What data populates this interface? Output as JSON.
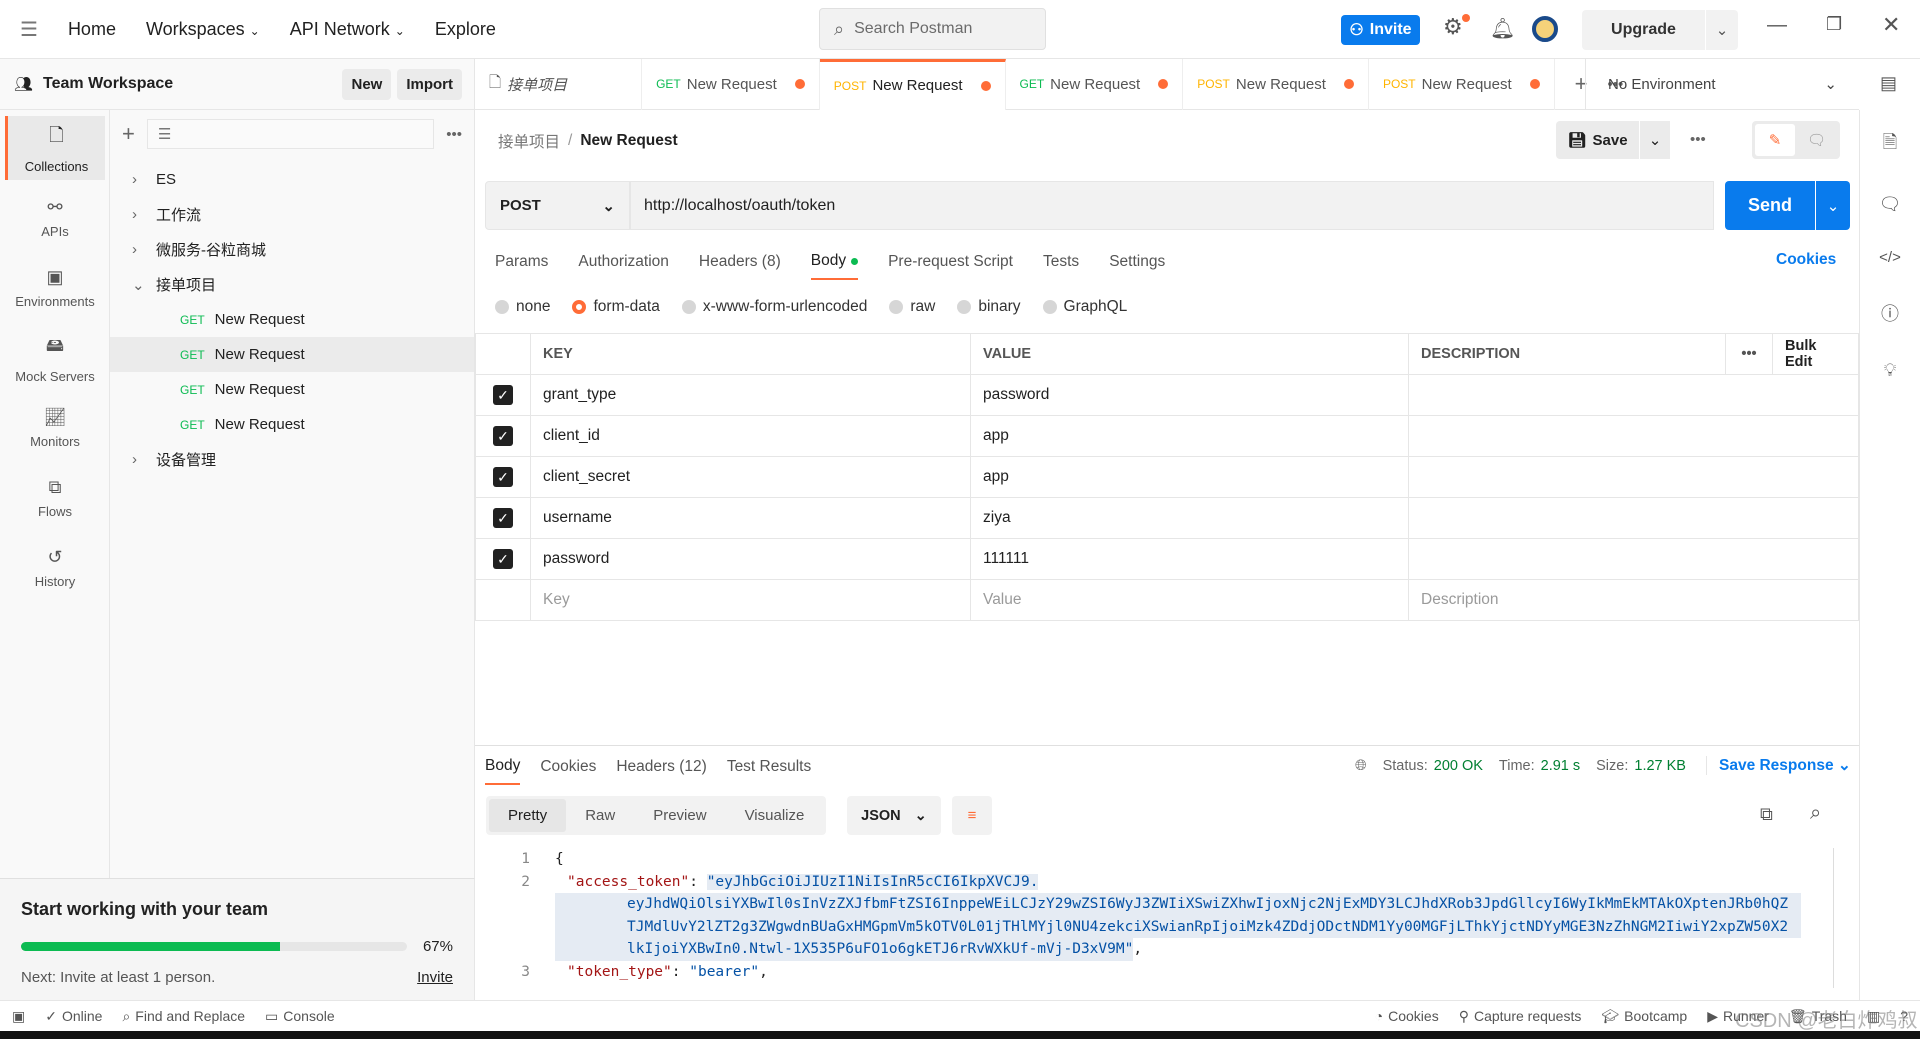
{
  "topbar": {
    "nav": [
      "Home",
      "Workspaces",
      "API Network",
      "Explore"
    ],
    "search_placeholder": "Search Postman",
    "invite": "Invite",
    "upgrade": "Upgrade"
  },
  "workspace": {
    "name": "Team Workspace",
    "new": "New",
    "import": "Import"
  },
  "tabs": [
    {
      "method": "",
      "label": "接单项目",
      "dirty": false
    },
    {
      "method": "GET",
      "label": "New Request",
      "dirty": true
    },
    {
      "method": "POST",
      "label": "New Request",
      "dirty": true,
      "active": true
    },
    {
      "method": "GET",
      "label": "New Request",
      "dirty": true
    },
    {
      "method": "POST",
      "label": "New Request",
      "dirty": true
    },
    {
      "method": "POST",
      "label": "New Request",
      "dirty": true
    }
  ],
  "environment": "No Environment",
  "sidebar": {
    "items": [
      "Collections",
      "APIs",
      "Environments",
      "Mock Servers",
      "Monitors",
      "Flows",
      "History"
    ]
  },
  "collections": [
    {
      "label": "ES",
      "expanded": false
    },
    {
      "label": "工作流",
      "expanded": false
    },
    {
      "label": "微服务-谷粒商城",
      "expanded": false
    },
    {
      "label": "接单项目",
      "expanded": true,
      "children": [
        {
          "method": "GET",
          "label": "New Request"
        },
        {
          "method": "GET",
          "label": "New Request",
          "selected": true
        },
        {
          "method": "GET",
          "label": "New Request"
        },
        {
          "method": "GET",
          "label": "New Request"
        }
      ]
    },
    {
      "label": "设备管理",
      "expanded": false
    }
  ],
  "onboarding": {
    "title": "Start working with your team",
    "progress_percent": 67,
    "progress_label": "67%",
    "next": "Next: Invite at least 1 person.",
    "invite": "Invite"
  },
  "request": {
    "breadcrumb": [
      "接单项目",
      "New Request"
    ],
    "save": "Save",
    "method": "POST",
    "url": "http://localhost/oauth/token",
    "send": "Send",
    "tabs": [
      "Params",
      "Authorization",
      "Headers (8)",
      "Body",
      "Pre-request Script",
      "Tests",
      "Settings"
    ],
    "active_tab": "Body",
    "cookies": "Cookies",
    "body_types": [
      "none",
      "form-data",
      "x-www-form-urlencoded",
      "raw",
      "binary",
      "GraphQL"
    ],
    "body_type": "form-data",
    "table": {
      "headers": [
        "KEY",
        "VALUE",
        "DESCRIPTION"
      ],
      "bulk_edit": "Bulk Edit",
      "rows": [
        {
          "key": "grant_type",
          "value": "password"
        },
        {
          "key": "client_id",
          "value": "app"
        },
        {
          "key": "client_secret",
          "value": "app"
        },
        {
          "key": "username",
          "value": "ziya"
        },
        {
          "key": "password",
          "value": "111111"
        }
      ],
      "placeholders": {
        "key": "Key",
        "value": "Value",
        "description": "Description"
      }
    }
  },
  "response": {
    "tabs": [
      "Body",
      "Cookies",
      "Headers (12)",
      "Test Results"
    ],
    "status_label": "Status:",
    "status": "200 OK",
    "time_label": "Time:",
    "time": "2.91 s",
    "size_label": "Size:",
    "size": "1.27 KB",
    "save_response": "Save Response",
    "views": [
      "Pretty",
      "Raw",
      "Preview",
      "Visualize"
    ],
    "format": "JSON",
    "lines": {
      "l1": "{",
      "key2": "\"access_token\"",
      "tok1": "\"eyJhbGciOiJIUzI1NiIsInR5cCI6IkpXVCJ9.",
      "tok2": "eyJhdWQiOlsiYXBwIl0sInVzZXJfbmFtZSI6InppeWEiLCJzY29wZSI6WyJ3ZWIiXSwiZXhwIjoxNjc2NjExMDY3LCJhdXRob3JpdGllcyI6WyIkMmEkMTAkOXptenJRb0hQZ",
      "tok3": "TJMdlUvY2lZT2g3ZWgwdnBUaGxHMGpmVm5kOTV0L01jTHlMYjl0NU4zekciXSwianRpIjoiMzk4ZDdjODctNDM1Yy00MGFjLThkYjctNDYyMGE3NzZhNGM2IiwiY2xpZW50X2",
      "tok4": "lkIjoiYXBwIn0.Ntwl-1X535P6uFO1o6gkETJ6rRvWXkUf-mVj-D3xV9M\"",
      "key3": "\"token_type\"",
      "val3": "\"bearer\""
    }
  },
  "statusbar": {
    "left": [
      "Online",
      "Find and Replace",
      "Console"
    ],
    "right": [
      "Cookies",
      "Capture requests",
      "Bootcamp",
      "Runner",
      "Trash"
    ]
  },
  "watermark": "CSDN @老白炸鸡叔",
  "colors": {
    "accent": "#ff6c37",
    "primary": "#097bed",
    "get": "#0cbb52",
    "post": "#ffb400",
    "success": "#007f31"
  }
}
